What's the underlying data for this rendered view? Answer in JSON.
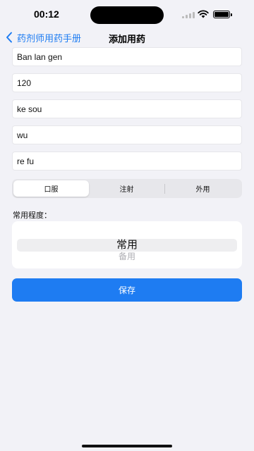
{
  "status_bar": {
    "time": "00:12"
  },
  "nav": {
    "back_label": "药剂师用药手册",
    "title": "添加用药"
  },
  "form": {
    "fields": [
      {
        "value": "Ban lan gen"
      },
      {
        "value": "120"
      },
      {
        "value": "ke sou"
      },
      {
        "value": "wu"
      },
      {
        "value": "re fu"
      }
    ]
  },
  "route_segments": {
    "options": [
      "口服",
      "注射",
      "外用"
    ],
    "selected": "口服"
  },
  "frequency": {
    "label": "常用程度：",
    "selected": "常用",
    "next": "备用"
  },
  "actions": {
    "save_label": "保存"
  },
  "colors": {
    "accent": "#1E7CF2",
    "background": "#F2F2F7"
  },
  "icons": {
    "back": "chevron-left-icon",
    "signal": "cellular-signal-icon",
    "wifi": "wifi-icon",
    "battery": "battery-icon"
  }
}
